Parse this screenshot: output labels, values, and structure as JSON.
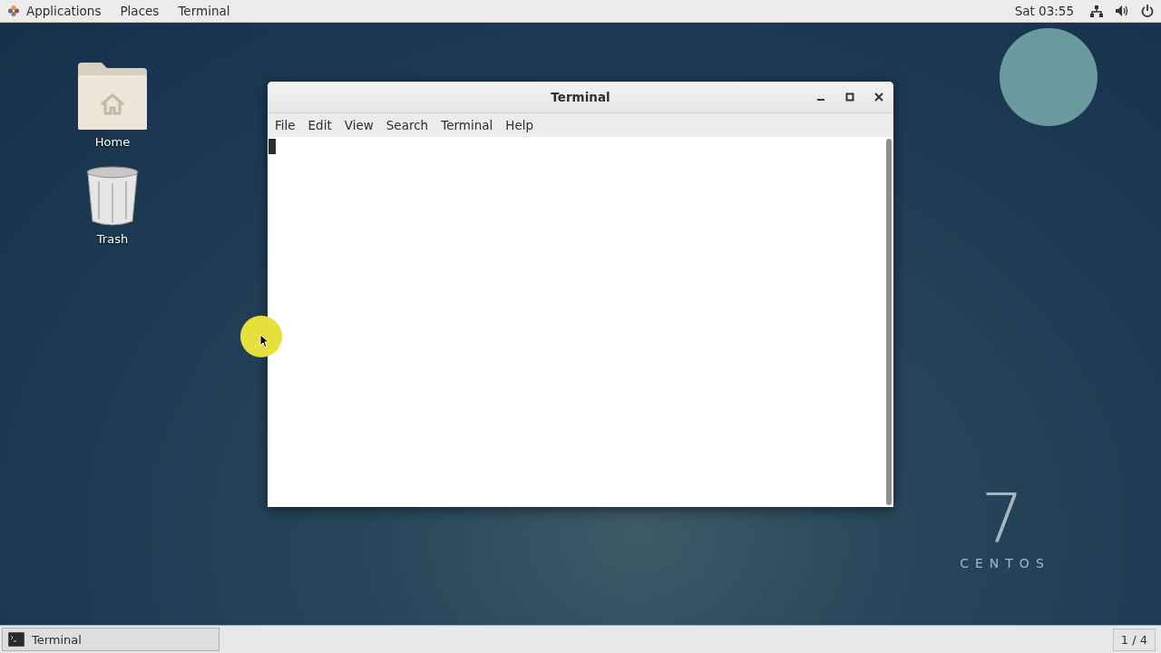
{
  "top_bar": {
    "menus": [
      "Applications",
      "Places",
      "Terminal"
    ],
    "clock": "Sat 03:55"
  },
  "desktop_icons": [
    {
      "label": "Home",
      "kind": "folder"
    },
    {
      "label": "Trash",
      "kind": "trash"
    }
  ],
  "window": {
    "title": "Terminal",
    "menu": [
      "File",
      "Edit",
      "View",
      "Search",
      "Terminal",
      "Help"
    ]
  },
  "wallpaper_logo": {
    "number": "7",
    "word": "CENTOS"
  },
  "taskbar": {
    "tasks": [
      "Terminal"
    ],
    "workspace": "1 / 4"
  }
}
